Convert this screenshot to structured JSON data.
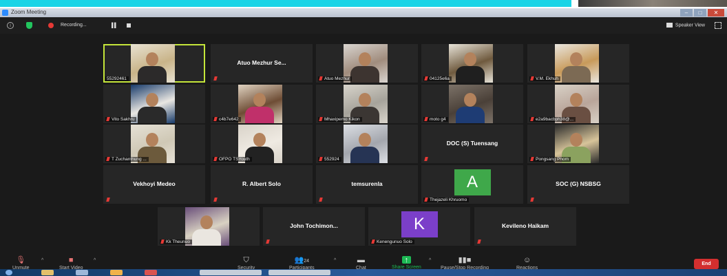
{
  "window": {
    "title": "Zoom Meeting"
  },
  "meeting_bar": {
    "recording_label": "Recording...",
    "view_label": "Speaker View"
  },
  "tiles": [
    {
      "name": "55292461",
      "active": true,
      "type": "video",
      "palette": [
        "#c9b489",
        "#e8e2d2",
        "#2c2a2a"
      ]
    },
    {
      "name": "Atuo Mezhur Se...",
      "type": "name"
    },
    {
      "name": "Atuo Mezhur",
      "type": "video",
      "palette": [
        "#a08c7d",
        "#d9d5d0",
        "#3d3430"
      ]
    },
    {
      "name": "04125e6a",
      "type": "video",
      "palette": [
        "#6f5a3e",
        "#e7e3d8",
        "#1f1f1f"
      ]
    },
    {
      "name": "V.M. Ekhuh",
      "type": "video",
      "palette": [
        "#c89a5a",
        "#e9e6df",
        "#7c6a54"
      ]
    },
    {
      "name": "Vito Sakhru",
      "type": "video",
      "palette": [
        "#eae7e2",
        "#173a6a",
        "#2a2a2a"
      ]
    },
    {
      "name": "c4b7e642",
      "type": "video",
      "palette": [
        "#6e4d35",
        "#e0d3c1",
        "#c0306a"
      ]
    },
    {
      "name": "Mhaxipemo Kikon",
      "type": "video",
      "palette": [
        "#a6a39b",
        "#d8d4cb",
        "#3b3633"
      ]
    },
    {
      "name": "moto g4",
      "type": "video",
      "palette": [
        "#4a4038",
        "#7c7268",
        "#1e3c74"
      ]
    },
    {
      "name": "e2a9bacbph38@...",
      "type": "video",
      "palette": [
        "#b9a59a",
        "#d8d1c6",
        "#6a4f42"
      ]
    },
    {
      "name": "T Zuchanthung ...",
      "type": "video",
      "palette": [
        "#cfc8b5",
        "#e6e1d6",
        "#6c5a3c"
      ]
    },
    {
      "name": "OFPO TSYouth",
      "type": "video",
      "palette": [
        "#efeae2",
        "#d9d3c9",
        "#222"
      ]
    },
    {
      "name": "552924",
      "type": "video",
      "palette": [
        "#a3a6ad",
        "#dcdfe4",
        "#263454"
      ]
    },
    {
      "name": "DOC (S) Tuensang",
      "type": "name"
    },
    {
      "name": "Pongsang Phom",
      "type": "video",
      "palette": [
        "#d7c49a",
        "#2b2b2b",
        "#8ba25f"
      ]
    },
    {
      "name": "Vekhoyi Medeo",
      "type": "name"
    },
    {
      "name": "R. Albert Solo",
      "type": "name"
    },
    {
      "name": "temsurenla",
      "type": "name"
    },
    {
      "name": "Thejazeli Khruomo",
      "type": "avatar",
      "letter": "A",
      "avatar_color": "#3fa84a"
    },
    {
      "name": "SOC (G) NSBSG",
      "type": "name"
    },
    {
      "name": "Kk Theunuo",
      "type": "video",
      "palette": [
        "#d9d2c2",
        "#6a4f7a",
        "#eae6e0"
      ]
    },
    {
      "name": "John Tochimon...",
      "type": "name"
    },
    {
      "name": "Kenengunuo Solo",
      "type": "avatar",
      "letter": "K",
      "avatar_color": "#7b3fc9"
    },
    {
      "name": "Kevileno Haikam",
      "type": "name"
    }
  ],
  "toolbar": {
    "unmute": "Unmute",
    "start_video": "Start Video",
    "security": "Security",
    "participants": "Participants",
    "participants_count": "24",
    "chat": "Chat",
    "share_screen": "Share Screen",
    "pause_stop_recording": "Pause/Stop Recording",
    "reactions": "Reactions",
    "end": "End"
  },
  "colors": {
    "active_speaker_border": "#c5e63a",
    "share_green": "#1db954",
    "end_red": "#d32f2f",
    "muted_red": "#e53935"
  }
}
